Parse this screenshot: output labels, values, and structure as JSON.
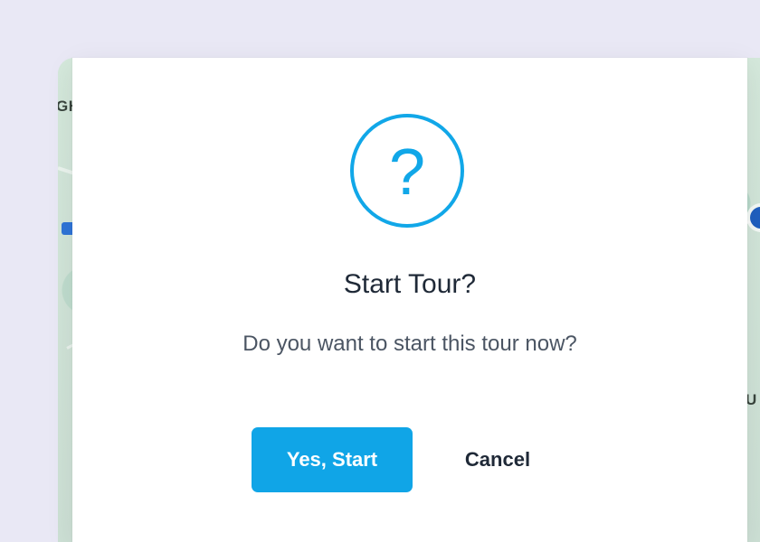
{
  "dialog": {
    "icon_name": "question-icon",
    "icon_glyph": "?",
    "title": "Start Tour?",
    "message": "Do you want to start this tour now?",
    "primary_button_label": "Yes, Start",
    "secondary_button_label": "Cancel"
  },
  "map": {
    "left_label": "GH",
    "right_label": "U"
  },
  "colors": {
    "accent": "#10A5E7",
    "page_background": "#E9E8F5",
    "dialog_background": "#FFFFFF",
    "text_primary": "#1F2937",
    "text_secondary": "#4B5563"
  }
}
